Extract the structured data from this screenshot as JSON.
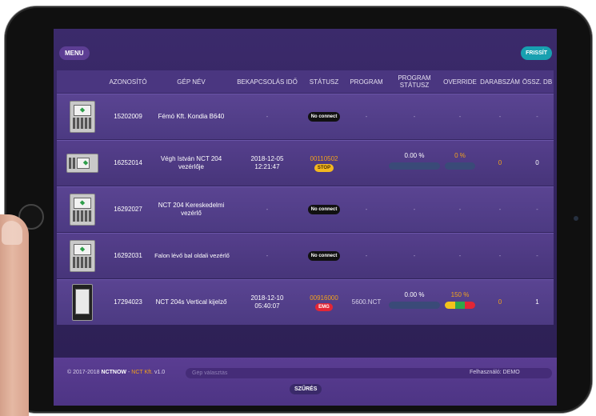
{
  "header": {
    "menu_label": "MENU",
    "refresh_label": "FRISSÍT"
  },
  "table": {
    "columns": [
      "AZONOSÍTÓ",
      "GÉP NÉV",
      "BEKAPCSOLÁS IDŐ",
      "STÁTUSZ",
      "PROGRAM",
      "PROGRAM STÁTUSZ",
      "OVERRIDE",
      "DARABSZÁM",
      "ÖSSZ. DB"
    ],
    "rows": [
      {
        "id": "15202009",
        "name": "Fémó Kft. Kondia B640",
        "uptime_date": "-",
        "uptime_time": "",
        "status_badge": "No connect",
        "program": "-",
        "program_status": "-",
        "override": "-",
        "count": "-",
        "total": "-"
      },
      {
        "id": "16252014",
        "name": "Végh István NCT 204 vezérlője",
        "uptime_date": "2018-12-05",
        "uptime_time": "12:21:47",
        "status_code": "00110502",
        "status_badge": "STOP",
        "program": "",
        "program_status": "0.00 %",
        "program_progress": 0,
        "override": "0 %",
        "override_level": 0,
        "count": "0",
        "total": "0"
      },
      {
        "id": "16292027",
        "name": "NCT 204 Kereskedelmi vezérlő",
        "uptime_date": "-",
        "uptime_time": "",
        "status_badge": "No connect",
        "program": "-",
        "program_status": "-",
        "override": "-",
        "count": "-",
        "total": "-"
      },
      {
        "id": "16292031",
        "name": "Falon lévő bal oldali vezérlő",
        "uptime_date": "-",
        "uptime_time": "",
        "status_badge": "No connect",
        "program": "-",
        "program_status": "-",
        "override": "-",
        "count": "-",
        "total": "-"
      },
      {
        "id": "17294023",
        "name": "NCT 204s Vertical kijelző",
        "uptime_date": "2018-12-10",
        "uptime_time": "05:40:07",
        "status_code": "00916000",
        "status_badge": "EMG",
        "program": "5600.NCT",
        "program_status": "0.00 %",
        "program_progress": 0,
        "override": "150 %",
        "override_level": 1.5,
        "count": "0",
        "total": "1"
      }
    ]
  },
  "colors": {
    "accent_orange": "#f2a21b",
    "refresh_button": "#18a0b0",
    "stop_badge": "#f3b820",
    "emg_badge": "#e32636",
    "override_yellow": "#f3c21b",
    "override_green": "#2ea84a",
    "override_red": "#e32636"
  },
  "footer": {
    "copyright_prefix": "© 2017-2018",
    "brand": "NCTNOW",
    "separator": " - ",
    "company": "NCT Kft.",
    "version": "v1.0",
    "machine_select_placeholder": "Gép választás",
    "user_label": "Felhasználó: DEMO",
    "filter_label": "SZŰRÉS"
  }
}
